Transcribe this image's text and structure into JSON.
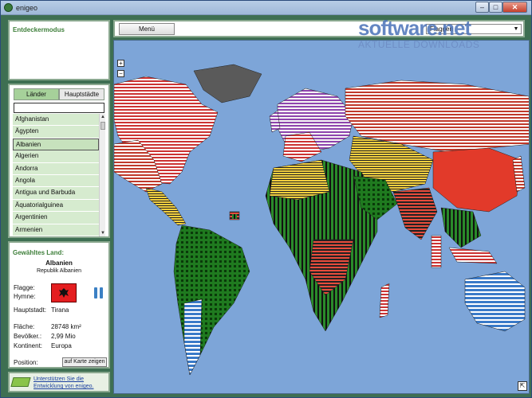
{
  "window": {
    "title": "enigeo",
    "minimize": "–",
    "maximize": "□",
    "close": "✕"
  },
  "mode_panel": {
    "title": "Entdeckermodus"
  },
  "list_panel": {
    "tabs": [
      "Länder",
      "Hauptstädte"
    ],
    "search_value": "",
    "items": [
      "Afghanistan",
      "Ägypten",
      "Albanien",
      "Algerien",
      "Andorra",
      "Angola",
      "Antigua und Barbuda",
      "Äquatorialguinea",
      "Argentinien",
      "Armenien"
    ],
    "selected_index": 2
  },
  "info_panel": {
    "title": "Gewähltes Land:",
    "country": "Albanien",
    "full_name": "Republik Albanien",
    "flag_label": "Flagge:",
    "anthem_label": "Hymne:",
    "capital_label": "Hauptstadt:",
    "capital": "Tirana",
    "area_label": "Fläche:",
    "area": "28748 km²",
    "population_label": "Bevölker.:",
    "population": "2,99 Mio",
    "continent_label": "Kontinent:",
    "continent": "Europa",
    "position_label": "Position:",
    "show_on_map": "auf Karte zeigen",
    "flag_color": "#e41e20"
  },
  "support": {
    "text": "Unterstützen Sie die Entwicklung von enigeo."
  },
  "toolbar": {
    "menu_label": "Menü",
    "view_select": "Flaggen"
  },
  "map": {
    "zoom_in": "+",
    "zoom_out": "−",
    "resize": "⇱",
    "ocean_color": "#7da5d8"
  },
  "watermark": {
    "title": "software.net",
    "subtitle": "AKTUELLE DOWNLOADS"
  },
  "icons": [
    "app-globe-icon",
    "money-icon",
    "pause-icon",
    "flag-icon",
    "chevron-down-icon"
  ]
}
